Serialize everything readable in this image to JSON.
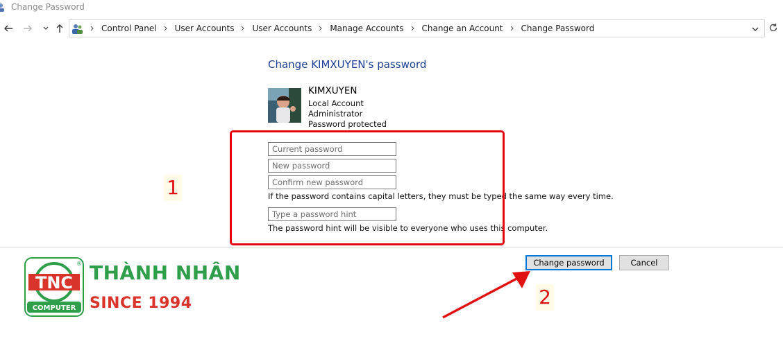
{
  "window": {
    "title": "Change Password"
  },
  "breadcrumb": [
    "Control Panel",
    "User Accounts",
    "User Accounts",
    "Manage Accounts",
    "Change an Account",
    "Change Password"
  ],
  "page": {
    "heading": "Change KIMXUYEN's password"
  },
  "user": {
    "name": "KIMXUYEN",
    "account_type": "Local Account",
    "role": "Administrator",
    "status": "Password protected"
  },
  "form": {
    "current_password": {
      "placeholder": "Current password",
      "value": ""
    },
    "new_password": {
      "placeholder": "New password",
      "value": ""
    },
    "confirm_password": {
      "placeholder": "Confirm new password",
      "value": ""
    },
    "capital_note": "If the password contains capital letters, they must be typed the same way every time.",
    "hint": {
      "placeholder": "Type a password hint",
      "value": ""
    },
    "hint_note": "The password hint will be visible to everyone who uses this computer."
  },
  "buttons": {
    "change": "Change password",
    "cancel": "Cancel"
  },
  "annotations": {
    "step1": "1",
    "step2": "2"
  },
  "logo": {
    "initials": "TNC",
    "tagline": "COMPUTER",
    "brand": "THÀNH NHÂN",
    "since": "SINCE 1994",
    "registered": "®"
  },
  "colors": {
    "highlight_red": "#e30613",
    "brand_green": "#2e9e4a",
    "brand_red": "#d9342b",
    "heading_blue": "#1c3f94"
  }
}
